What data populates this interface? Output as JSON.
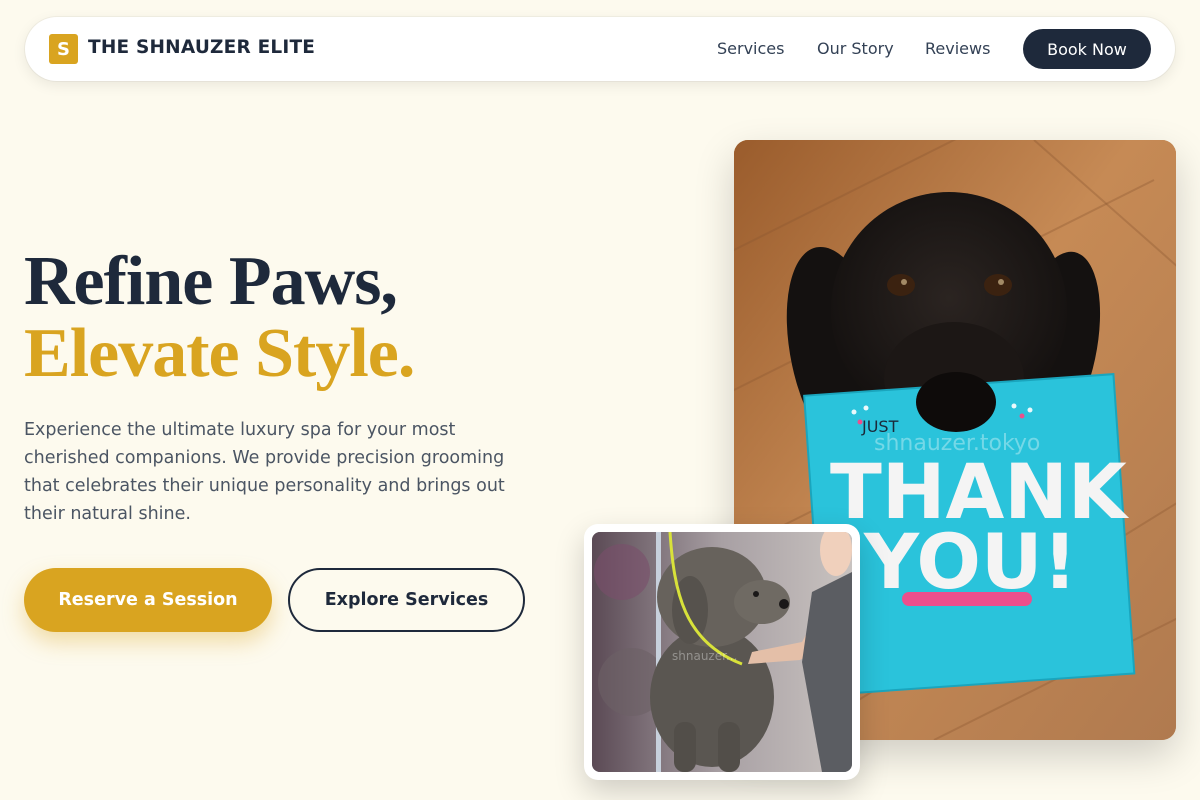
{
  "brand": {
    "logo_letter": "S",
    "name": "THE SHNAUZER ELITE"
  },
  "nav": {
    "links": [
      "Services",
      "Our Story",
      "Reviews"
    ],
    "cta": "Book Now"
  },
  "hero": {
    "headline_line1": "Refine Paws,",
    "headline_line2": "Elevate Style.",
    "description": "Experience the ultimate luxury spa for your most cherished companions. We provide precision grooming that celebrates their unique personality and brings out their natural shine.",
    "primary_button": "Reserve a Session",
    "secondary_button": "Explore Services"
  },
  "images": {
    "main": {
      "card_text_top": "JUST",
      "card_text_main1": "THANK",
      "card_text_main2": "YOU!",
      "watermark": "shnauzer.tokyo"
    },
    "small": {
      "watermark": "shnauzer..."
    }
  },
  "colors": {
    "background": "#fdfaee",
    "navy": "#1e293b",
    "gold": "#d9a420",
    "card_teal": "#29c4dc"
  }
}
